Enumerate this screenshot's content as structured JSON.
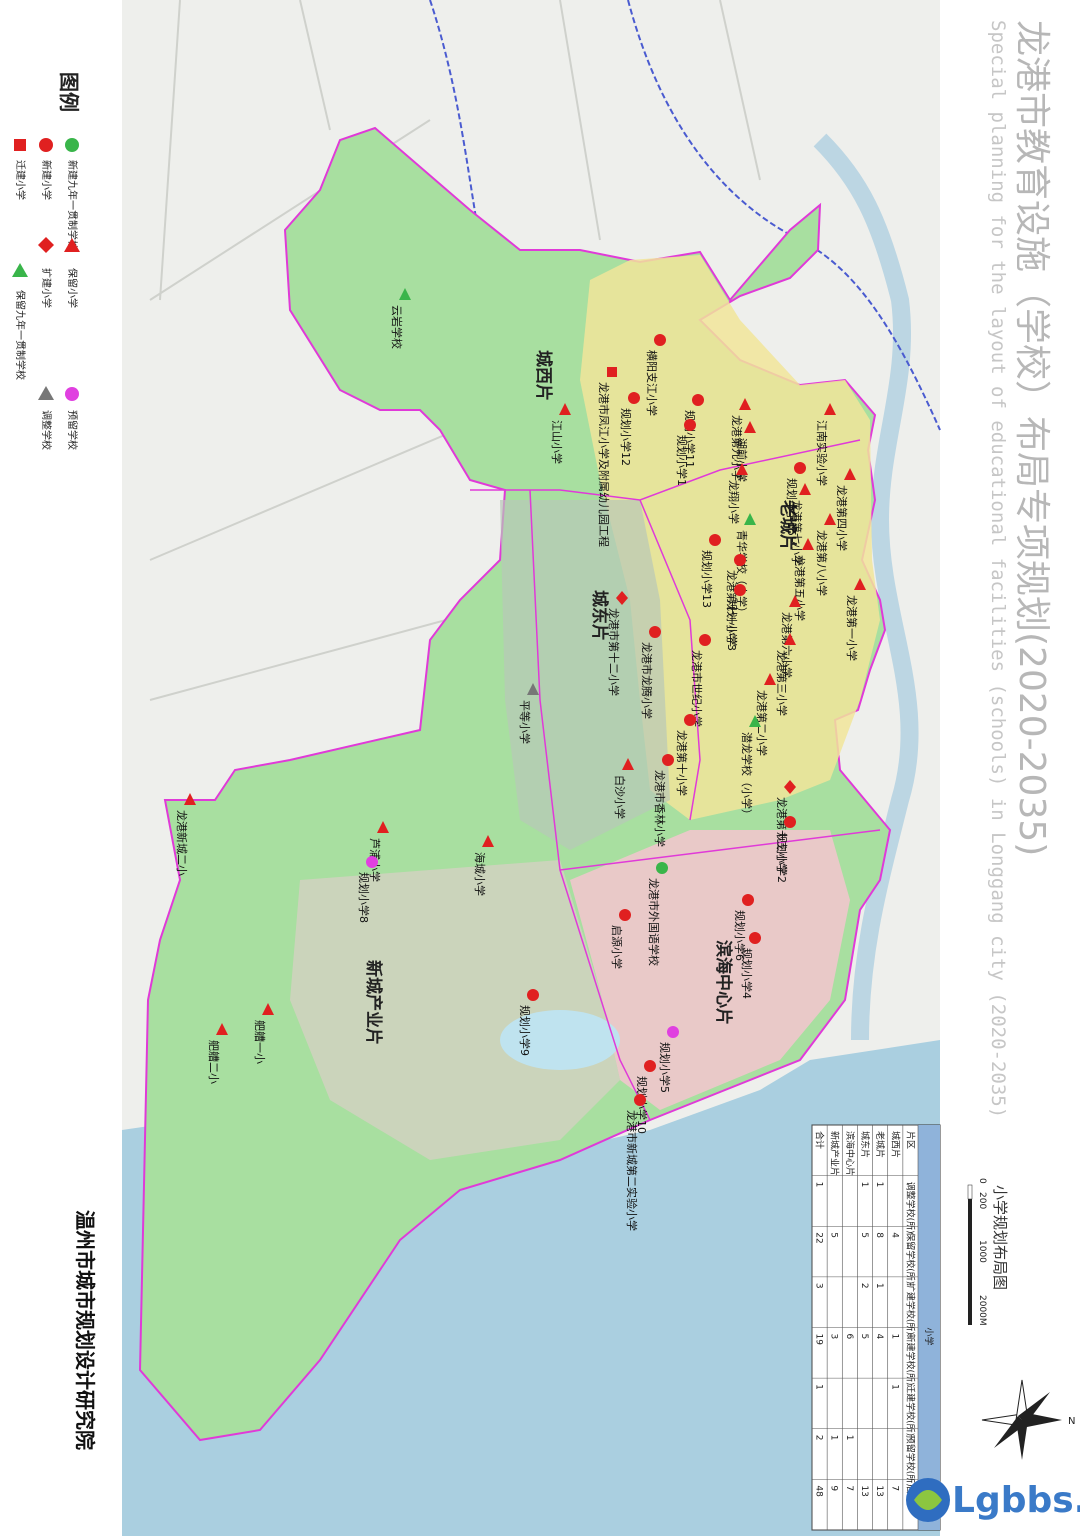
{
  "title_cn": "龙港市教育设施（学校）布局专项规划(2020-2035)",
  "title_en": "Special planning for the layout of educational facilities (schools) in Longgang city (2020-2035)",
  "institute": "温州市城市规划设计研究院",
  "watermark": "Lgbbs.cn",
  "legend": {
    "title": "图例",
    "items": [
      {
        "symbol": "green-circle",
        "label": "新建九年一贯制学校"
      },
      {
        "symbol": "red-triangle",
        "label": "保留小学"
      },
      {
        "symbol": "magenta-circle",
        "label": "预留学校"
      },
      {
        "symbol": "red-circle",
        "label": "新建小学"
      },
      {
        "symbol": "red-diamond",
        "label": "扩建小学"
      },
      {
        "symbol": "gray-triangle",
        "label": "调整学校"
      },
      {
        "symbol": "red-square",
        "label": "迁建小学"
      },
      {
        "symbol": "green-triangle",
        "label": "保留九年一贯制学校"
      }
    ]
  },
  "scale": {
    "title": "小学规划布局图",
    "ticks": [
      "0",
      "200",
      "1000",
      "2000M"
    ]
  },
  "districts": [
    {
      "id": "chengxi",
      "label": "城西片"
    },
    {
      "id": "laocheng",
      "label": "老城片"
    },
    {
      "id": "chengdong",
      "label": "城东片"
    },
    {
      "id": "binhai",
      "label": "滨海中心片"
    },
    {
      "id": "xincheng",
      "label": "新城产业片"
    }
  ],
  "schools": [
    {
      "label": "云岩学校",
      "type": "green-triangle"
    },
    {
      "label": "龙港市凤江小学及附属幼儿园工程",
      "type": "red-square"
    },
    {
      "label": "横阳支江小学",
      "type": "red-circle"
    },
    {
      "label": "江山小学",
      "type": "red-triangle"
    },
    {
      "label": "规划小学12",
      "type": "red-circle"
    },
    {
      "label": "规划小学11",
      "type": "red-circle"
    },
    {
      "label": "龙港第九小学",
      "type": "red-triangle"
    },
    {
      "label": "江南实验小学",
      "type": "red-triangle"
    },
    {
      "label": "湖前小学",
      "type": "red-triangle"
    },
    {
      "label": "规划小学1",
      "type": "red-circle"
    },
    {
      "label": "龙翔小学",
      "type": "red-triangle"
    },
    {
      "label": "规划小学15",
      "type": "red-circle"
    },
    {
      "label": "龙港第七小学",
      "type": "red-triangle"
    },
    {
      "label": "青华学校（小学）",
      "type": "green-triangle"
    },
    {
      "label": "规划小学13",
      "type": "red-circle"
    },
    {
      "label": "龙港第四小学",
      "type": "red-triangle"
    },
    {
      "label": "龙港第八小学",
      "type": "red-triangle"
    },
    {
      "label": "龙港第五小学",
      "type": "red-triangle"
    },
    {
      "label": "龙港第十一小学",
      "type": "red-circle"
    },
    {
      "label": "龙港市第十二小学",
      "type": "red-diamond"
    },
    {
      "label": "规划小学3",
      "type": "red-circle"
    },
    {
      "label": "龙港第六小学",
      "type": "red-triangle"
    },
    {
      "label": "龙港第一小学",
      "type": "red-triangle"
    },
    {
      "label": "龙港第三小学",
      "type": "red-triangle"
    },
    {
      "label": "龙港市龙腾小学",
      "type": "red-circle"
    },
    {
      "label": "龙港市世纪小学",
      "type": "red-circle"
    },
    {
      "label": "平等小学",
      "type": "gray-triangle"
    },
    {
      "label": "龙港第二小学",
      "type": "red-triangle"
    },
    {
      "label": "潜龙学校（小学）",
      "type": "green-triangle"
    },
    {
      "label": "龙港第十小学",
      "type": "red-circle"
    },
    {
      "label": "白沙小学",
      "type": "red-triangle"
    },
    {
      "label": "龙港市香林小学",
      "type": "red-circle"
    },
    {
      "label": "龙港第十三小学",
      "type": "red-diamond"
    },
    {
      "label": "规划小学2",
      "type": "red-circle"
    },
    {
      "label": "龙港新城二小",
      "type": "red-triangle"
    },
    {
      "label": "芦浦小学",
      "type": "red-triangle"
    },
    {
      "label": "海城小学",
      "type": "red-triangle"
    },
    {
      "label": "规划小学8",
      "type": "magenta-circle"
    },
    {
      "label": "龙港市外国语学校",
      "type": "green-circle"
    },
    {
      "label": "规划小学6",
      "type": "red-circle"
    },
    {
      "label": "启源小学",
      "type": "red-circle"
    },
    {
      "label": "规划小学4",
      "type": "red-circle"
    },
    {
      "label": "规划小学9",
      "type": "red-circle"
    },
    {
      "label": "舥艚一小",
      "type": "red-triangle"
    },
    {
      "label": "舥艚二小",
      "type": "red-triangle"
    },
    {
      "label": "规划小学5",
      "type": "magenta-circle"
    },
    {
      "label": "规划小学10",
      "type": "red-circle"
    },
    {
      "label": "龙港市新城第二实验小学",
      "type": "red-circle"
    }
  ],
  "table": {
    "header_main": "小学",
    "headers": [
      "片区",
      "调整学校(所)",
      "保留学校(所)",
      "扩建学校(所)",
      "新建学校(所)",
      "迁建学校(所)",
      "预留学校(所)",
      "合计"
    ],
    "rows": [
      [
        "城西片",
        "",
        "4",
        "",
        "1",
        "1",
        "",
        "7"
      ],
      [
        "老城片",
        "1",
        "8",
        "1",
        "4",
        "",
        "",
        "13"
      ],
      [
        "城东片",
        "1",
        "5",
        "2",
        "5",
        "",
        "",
        "13"
      ],
      [
        "滨海中心片",
        "",
        "",
        "",
        "6",
        "",
        "1",
        "7"
      ],
      [
        "新城产业片",
        "",
        "5",
        "",
        "3",
        "",
        "1",
        "9"
      ],
      [
        "合计",
        "1",
        "22",
        "3",
        "19",
        "1",
        "2",
        "48"
      ]
    ]
  },
  "colors": {
    "boundary": "#e03ad8",
    "land": "#a8dfa0",
    "sea": "#aacfe0",
    "red": "#e02020",
    "green": "#39b54a",
    "magenta": "#e040e0"
  }
}
